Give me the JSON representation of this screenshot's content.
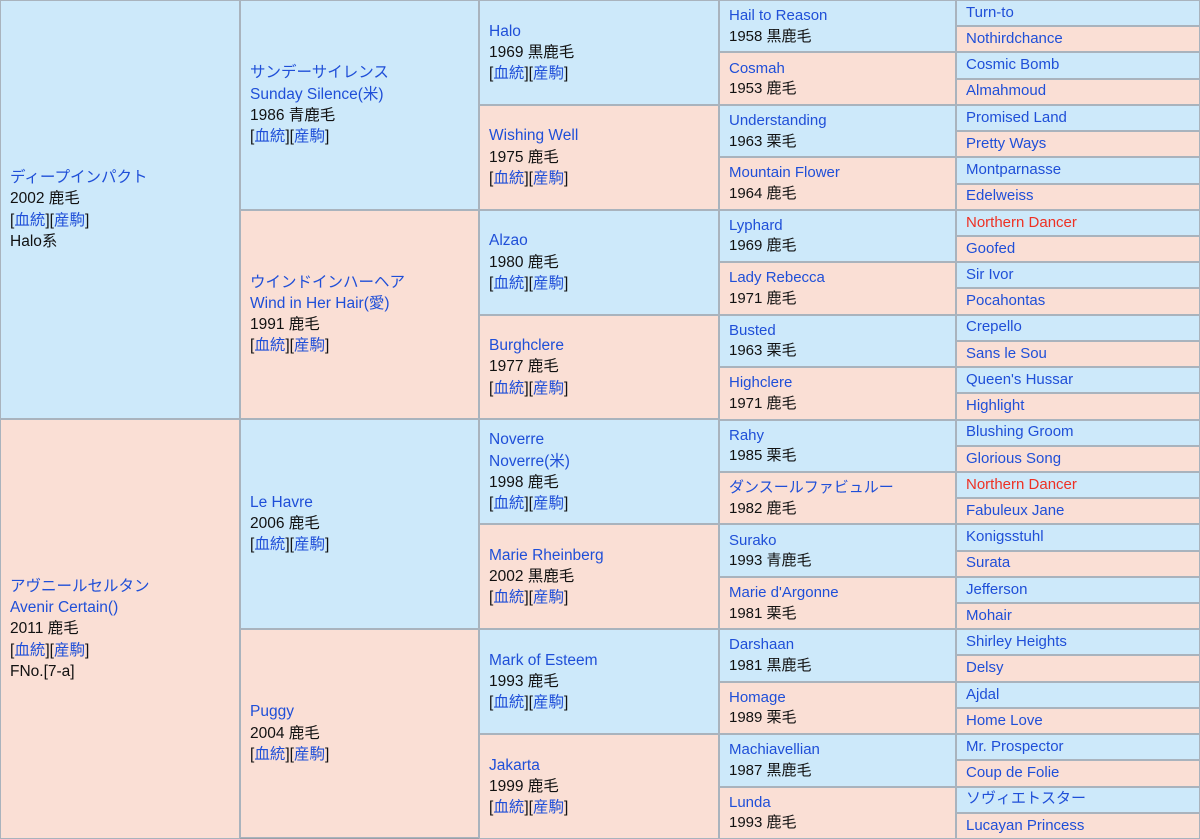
{
  "colors": {
    "sire_bg": "#cde9fa",
    "dam_bg": "#fadfd5",
    "link": "#1f4fd8",
    "inbred": "#ee3124",
    "border": "#a9b3bd",
    "text": "#111111"
  },
  "link_labels": {
    "pedigree": "血統",
    "offspring": "産駒",
    "open_bracket": "[",
    "close_bracket": "]"
  },
  "generation1": [
    {
      "name_jp": "ディープインパクト",
      "name_en": "",
      "meta": "2002 鹿毛",
      "extra": "Halo系",
      "sex": "sire"
    },
    {
      "name_jp": "アヴニールセルタン",
      "name_en": "Avenir Certain()",
      "meta": "2011 鹿毛",
      "extra": "FNo.[7-a]",
      "sex": "dam"
    }
  ],
  "generation2": [
    {
      "name_jp": "サンデーサイレンス",
      "name_en": "Sunday Silence(米)",
      "meta": "1986 青鹿毛",
      "sex": "sire"
    },
    {
      "name_jp": "ウインドインハーヘア",
      "name_en": "Wind in Her Hair(愛)",
      "meta": "1991 鹿毛",
      "sex": "dam"
    },
    {
      "name_jp": "",
      "name_en": "Le Havre",
      "meta": "2006 鹿毛",
      "sex": "sire"
    },
    {
      "name_jp": "",
      "name_en": "Puggy",
      "meta": "2004 鹿毛",
      "sex": "dam"
    }
  ],
  "generation3": [
    {
      "name_jp": "",
      "name_en": "Halo",
      "meta": "1969 黒鹿毛",
      "sex": "sire"
    },
    {
      "name_jp": "",
      "name_en": "Wishing Well",
      "meta": "1975 鹿毛",
      "sex": "dam"
    },
    {
      "name_jp": "",
      "name_en": "Alzao",
      "meta": "1980 鹿毛",
      "sex": "sire"
    },
    {
      "name_jp": "",
      "name_en": "Burghclere",
      "meta": "1977 鹿毛",
      "sex": "dam"
    },
    {
      "name_jp": "Noverre",
      "name_en": "Noverre(米)",
      "meta": "1998 鹿毛",
      "sex": "sire"
    },
    {
      "name_jp": "",
      "name_en": "Marie Rheinberg",
      "meta": "2002 黒鹿毛",
      "sex": "dam"
    },
    {
      "name_jp": "",
      "name_en": "Mark of Esteem",
      "meta": "1993 鹿毛",
      "sex": "sire"
    },
    {
      "name_jp": "",
      "name_en": "Jakarta",
      "meta": "1999 鹿毛",
      "sex": "dam"
    }
  ],
  "generation4": [
    {
      "name": "Hail to Reason",
      "meta": "1958 黒鹿毛",
      "sex": "sire"
    },
    {
      "name": "Cosmah",
      "meta": "1953 鹿毛",
      "sex": "dam"
    },
    {
      "name": "Understanding",
      "meta": "1963 栗毛",
      "sex": "sire"
    },
    {
      "name": "Mountain Flower",
      "meta": "1964 鹿毛",
      "sex": "dam"
    },
    {
      "name": "Lyphard",
      "meta": "1969 鹿毛",
      "sex": "sire"
    },
    {
      "name": "Lady Rebecca",
      "meta": "1971 鹿毛",
      "sex": "dam"
    },
    {
      "name": "Busted",
      "meta": "1963 栗毛",
      "sex": "sire"
    },
    {
      "name": "Highclere",
      "meta": "1971 鹿毛",
      "sex": "dam"
    },
    {
      "name": "Rahy",
      "meta": "1985 栗毛",
      "sex": "sire"
    },
    {
      "name": "ダンスールファビュルー",
      "meta": "1982 鹿毛",
      "sex": "dam"
    },
    {
      "name": "Surako",
      "meta": "1993 青鹿毛",
      "sex": "sire"
    },
    {
      "name": "Marie d'Argonne",
      "meta": "1981 栗毛",
      "sex": "dam"
    },
    {
      "name": "Darshaan",
      "meta": "1981 黒鹿毛",
      "sex": "sire"
    },
    {
      "name": "Homage",
      "meta": "1989 栗毛",
      "sex": "dam"
    },
    {
      "name": "Machiavellian",
      "meta": "1987 黒鹿毛",
      "sex": "sire"
    },
    {
      "name": "Lunda",
      "meta": "1993 鹿毛",
      "sex": "dam"
    }
  ],
  "generation5": [
    {
      "name": "Turn-to",
      "sex": "sire",
      "inbred": false
    },
    {
      "name": "Nothirdchance",
      "sex": "dam",
      "inbred": false
    },
    {
      "name": "Cosmic Bomb",
      "sex": "sire",
      "inbred": false
    },
    {
      "name": "Almahmoud",
      "sex": "dam",
      "inbred": false
    },
    {
      "name": "Promised Land",
      "sex": "sire",
      "inbred": false
    },
    {
      "name": "Pretty Ways",
      "sex": "dam",
      "inbred": false
    },
    {
      "name": "Montparnasse",
      "sex": "sire",
      "inbred": false
    },
    {
      "name": "Edelweiss",
      "sex": "dam",
      "inbred": false
    },
    {
      "name": "Northern Dancer",
      "sex": "sire",
      "inbred": true
    },
    {
      "name": "Goofed",
      "sex": "dam",
      "inbred": false
    },
    {
      "name": "Sir Ivor",
      "sex": "sire",
      "inbred": false
    },
    {
      "name": "Pocahontas",
      "sex": "dam",
      "inbred": false
    },
    {
      "name": "Crepello",
      "sex": "sire",
      "inbred": false
    },
    {
      "name": "Sans le Sou",
      "sex": "dam",
      "inbred": false
    },
    {
      "name": "Queen's Hussar",
      "sex": "sire",
      "inbred": false
    },
    {
      "name": "Highlight",
      "sex": "dam",
      "inbred": false
    },
    {
      "name": "Blushing Groom",
      "sex": "sire",
      "inbred": false
    },
    {
      "name": "Glorious Song",
      "sex": "dam",
      "inbred": false
    },
    {
      "name": "Northern Dancer",
      "sex": "sire",
      "inbred": true
    },
    {
      "name": "Fabuleux Jane",
      "sex": "dam",
      "inbred": false
    },
    {
      "name": "Konigsstuhl",
      "sex": "sire",
      "inbred": false
    },
    {
      "name": "Surata",
      "sex": "dam",
      "inbred": false
    },
    {
      "name": "Jefferson",
      "sex": "sire",
      "inbred": false
    },
    {
      "name": "Mohair",
      "sex": "dam",
      "inbred": false
    },
    {
      "name": "Shirley Heights",
      "sex": "sire",
      "inbred": false
    },
    {
      "name": "Delsy",
      "sex": "dam",
      "inbred": false
    },
    {
      "name": "Ajdal",
      "sex": "sire",
      "inbred": false
    },
    {
      "name": "Home Love",
      "sex": "dam",
      "inbred": false
    },
    {
      "name": "Mr. Prospector",
      "sex": "sire",
      "inbred": false
    },
    {
      "name": "Coup de Folie",
      "sex": "dam",
      "inbred": false
    },
    {
      "name": "ソヴィエトスター",
      "sex": "sire",
      "inbred": false
    },
    {
      "name": "Lucayan Princess",
      "sex": "dam",
      "inbred": false
    }
  ]
}
